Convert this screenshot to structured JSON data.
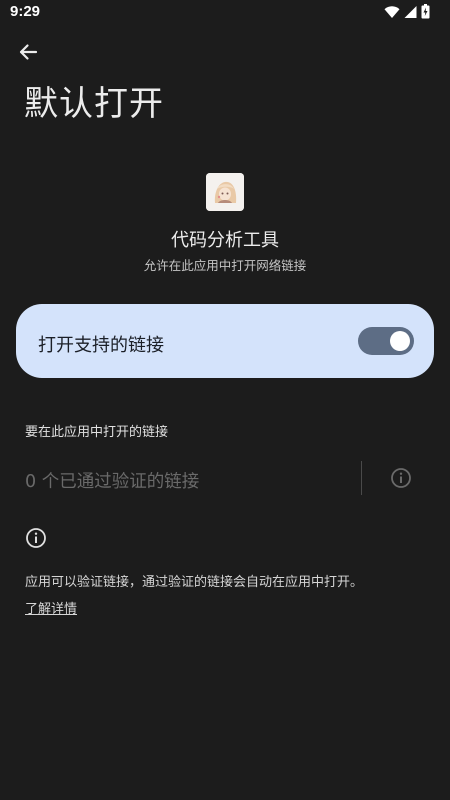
{
  "status_bar": {
    "time": "9:29"
  },
  "header": {
    "title": "默认打开"
  },
  "app": {
    "name": "代码分析工具",
    "subtitle": "允许在此应用中打开网络链接"
  },
  "toggle": {
    "label": "打开支持的链接",
    "enabled": true
  },
  "links_section": {
    "label": "要在此应用中打开的链接",
    "verified_text": "0 个已通过验证的链接"
  },
  "info": {
    "text": "应用可以验证链接，通过验证的链接会自动在应用中打开。",
    "learn_more": "了解详情"
  },
  "colors": {
    "background": "#1c1c1c",
    "card": "#d4e3fb",
    "switch_track": "#5d6d85"
  }
}
